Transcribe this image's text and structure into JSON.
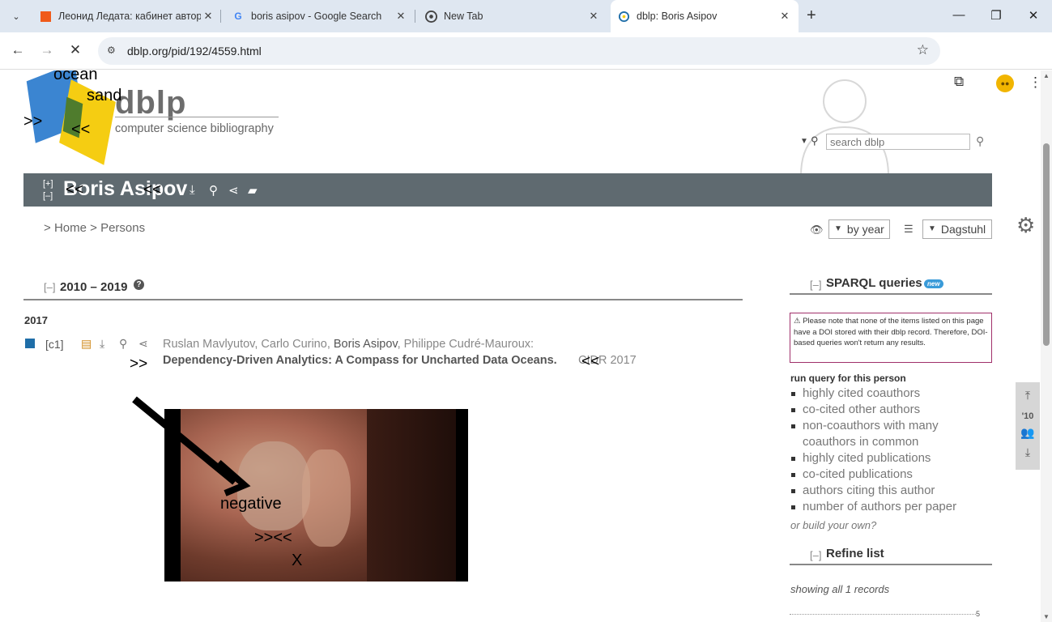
{
  "browser": {
    "tabs": [
      {
        "title": "Леонид Ледата: кабинет автор",
        "favicon": "orange-square"
      },
      {
        "title": "boris asipov - Google Search",
        "favicon": "G"
      },
      {
        "title": "New Tab",
        "favicon": "chrome"
      },
      {
        "title": "dblp: Boris Asipov",
        "favicon": "dblp",
        "active": true
      }
    ],
    "url": "dblp.org/pid/192/4559.html"
  },
  "logo": {
    "word": "dblp",
    "subtitle": "computer science bibliography"
  },
  "overlays": {
    "ocean": "ocean",
    "sand": "sand",
    "left_arrows": ">>",
    "right_arrows": "<<",
    "head_left": "<<",
    "head_right": "<<",
    "entry_left": ">>",
    "entry_right": "<<",
    "negative": "negative",
    "mid_arrows": ">><<",
    "x_mark": "X"
  },
  "search": {
    "placeholder": "search dblp"
  },
  "person": {
    "name": "Boris Asipov",
    "expand": "[+]",
    "collapse": "[–]"
  },
  "breadcrumb": {
    "prefix": ">",
    "home": "Home",
    "sep": ">",
    "persons": "Persons"
  },
  "view": {
    "order": "by year",
    "mirror": "Dagstuhl"
  },
  "section": {
    "toggle": "[–]",
    "title": "2010 – 2019",
    "help": "?",
    "year": "2017"
  },
  "entry": {
    "key": "[c1]",
    "authors": [
      {
        "name": "Ruslan Mavlyutov",
        "sep": ", ",
        "me": false
      },
      {
        "name": "Carlo Curino",
        "sep": ", ",
        "me": false
      },
      {
        "name": "Boris Asipov",
        "sep": ", ",
        "me": true
      },
      {
        "name": "Philippe Cudré-Mauroux",
        "sep": ":",
        "me": false
      }
    ],
    "title": "Dependency-Driven Analytics: A Compass for Uncharted Data Oceans.",
    "venue": "CIDR 2017"
  },
  "sidebar": {
    "sparql_toggle": "[–]",
    "sparql_title": "SPARQL queries",
    "new_badge": "new",
    "notice": "⚠ Please note that none of the items listed on this page have a DOI stored with their dblp record. Therefore, DOI-based queries won't return any results.",
    "run_label": "run query for this person",
    "queries": [
      "highly cited coauthors",
      "co-cited other authors",
      "non-coauthors with many coauthors in common",
      "highly cited publications",
      "co-cited publications",
      "authors citing this author",
      "number of authors per paper"
    ],
    "build_own": "or build your own?",
    "refine_toggle": "[–]",
    "refine_title": "Refine list",
    "showing": "showing all 1 records",
    "count": "5"
  },
  "side_nav": {
    "year_label": "'10"
  },
  "colors": {
    "headbar": "#5f6a70",
    "entry_marker": "#1f6ea8",
    "notice_border": "#a0306a",
    "new_badge": "#3a9bd9"
  }
}
